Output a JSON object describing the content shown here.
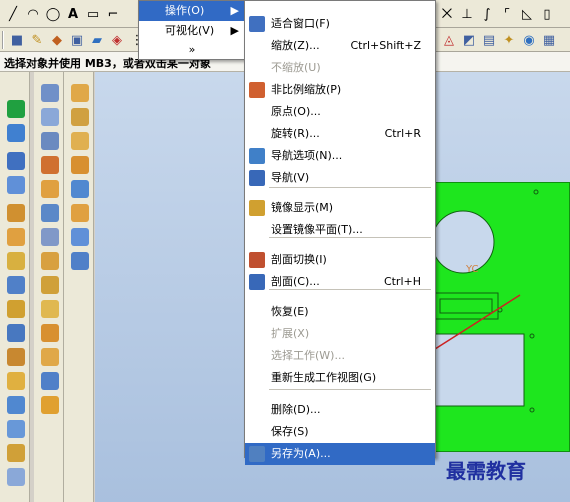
{
  "cue_line": "选择对象并使用 MB3，或者双击某一对象",
  "main_menu": {
    "items": [
      {
        "label": "操作(O)",
        "highlighted": true
      },
      {
        "label": "可视化(V)",
        "highlighted": false
      }
    ],
    "more": "»"
  },
  "submenu": {
    "items": [
      {
        "label": "适合窗口(F)",
        "shortcut": "",
        "enabled": true,
        "icon": "fit-window-icon"
      },
      {
        "label": "缩放(Z)...",
        "shortcut": "Ctrl+Shift+Z",
        "enabled": true,
        "icon": ""
      },
      {
        "label": "不缩放(U)",
        "shortcut": "",
        "enabled": false,
        "icon": ""
      },
      {
        "label": "非比例缩放(P)",
        "shortcut": "",
        "enabled": true,
        "icon": "nonuniform-scale-icon"
      },
      {
        "label": "原点(O)...",
        "shortcut": "",
        "enabled": true,
        "icon": ""
      },
      {
        "label": "旋转(R)...",
        "shortcut": "Ctrl+R",
        "enabled": true,
        "icon": ""
      },
      {
        "label": "导航选项(N)...",
        "shortcut": "",
        "enabled": true,
        "icon": "navigation-options-icon"
      },
      {
        "label": "导航(V)",
        "shortcut": "",
        "enabled": true,
        "icon": "navigate-icon"
      },
      {
        "label": "镜像显示(M)",
        "shortcut": "",
        "enabled": true,
        "icon": "mirror-display-icon"
      },
      {
        "label": "设置镜像平面(T)...",
        "shortcut": "",
        "enabled": true,
        "icon": ""
      },
      {
        "label": "剖面切换(I)",
        "shortcut": "",
        "enabled": true,
        "icon": "section-toggle-icon"
      },
      {
        "label": "剖面(C)...",
        "shortcut": "Ctrl+H",
        "enabled": true,
        "icon": "section-icon"
      },
      {
        "label": "恢复(E)",
        "shortcut": "",
        "enabled": true,
        "icon": ""
      },
      {
        "label": "扩展(X)",
        "shortcut": "",
        "enabled": false,
        "icon": ""
      },
      {
        "label": "选择工作(W)...",
        "shortcut": "",
        "enabled": false,
        "icon": ""
      },
      {
        "label": "重新生成工作视图(G)",
        "shortcut": "",
        "enabled": true,
        "icon": ""
      },
      {
        "label": "删除(D)...",
        "shortcut": "",
        "enabled": true,
        "icon": ""
      },
      {
        "label": "保存(S)",
        "shortcut": "",
        "enabled": true,
        "icon": ""
      },
      {
        "label": "另存为(A)...",
        "shortcut": "",
        "enabled": true,
        "icon": "save-as-icon",
        "highlighted": true
      }
    ]
  },
  "graphics": {
    "axis_label": "YC"
  },
  "watermark": "最需教育",
  "colors": {
    "part": "#1ee61e",
    "highlight": "#316ac5",
    "annotation": "#cc2222"
  }
}
